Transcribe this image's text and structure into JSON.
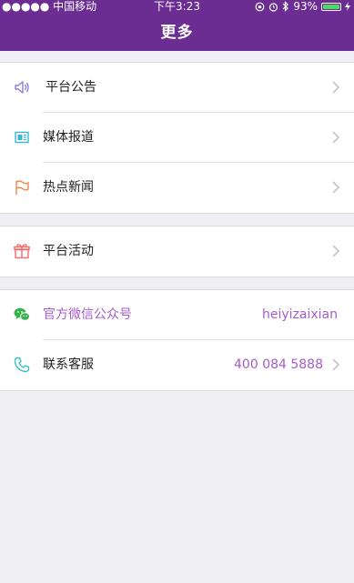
{
  "status_bar": {
    "carrier": "●●●●● 中国移动",
    "time": "下午3:23",
    "battery": "93%"
  },
  "header": {
    "title": "更多"
  },
  "sections": [
    {
      "items": [
        {
          "label": "平台公告",
          "icon": "speaker-icon"
        },
        {
          "label": "媒体报道",
          "icon": "newspaper-icon"
        },
        {
          "label": "热点新闻",
          "icon": "flag-icon"
        }
      ]
    },
    {
      "items": [
        {
          "label": "平台活动",
          "icon": "gift-icon"
        }
      ]
    },
    {
      "items": [
        {
          "label": "官方微信公众号",
          "value": "heiyizaixian",
          "icon": "wechat-icon"
        },
        {
          "label": "联系客服",
          "value": "400 084 5888",
          "icon": "phone-icon"
        }
      ]
    }
  ],
  "colors": {
    "header_bg": "#6b2d91",
    "accent_text": "#a45dc8",
    "speaker": "#8a7be0",
    "newspaper": "#38b6d6",
    "flag": "#f08a4b",
    "gift": "#ef6b6b",
    "wechat": "#33b24a",
    "phone": "#33c2c6"
  }
}
